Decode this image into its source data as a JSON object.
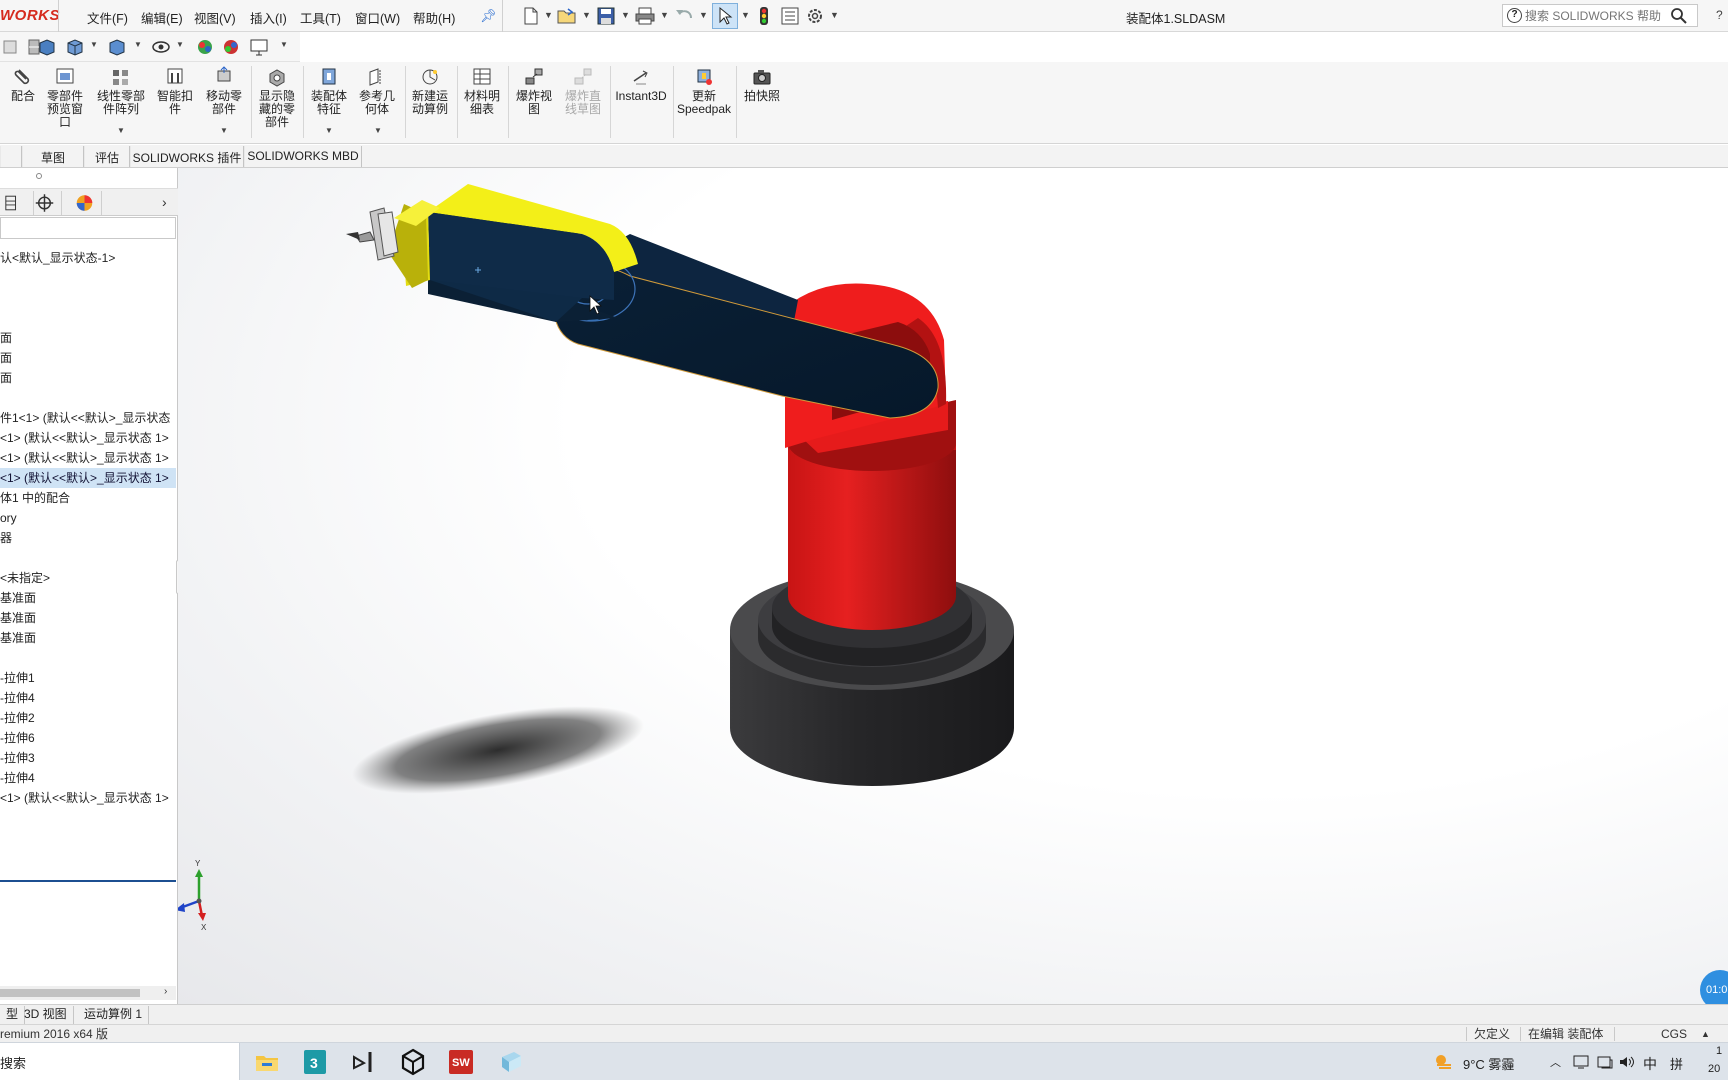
{
  "app": {
    "logo_text": "WORKS",
    "document_title": "装配体1.SLDASM"
  },
  "menu": {
    "items": [
      "文件(F)",
      "编辑(E)",
      "视图(V)",
      "插入(I)",
      "工具(T)",
      "窗口(W)",
      "帮助(H)"
    ]
  },
  "help_search": {
    "placeholder": "搜索 SOLIDWORKS 帮助",
    "help_label": "?"
  },
  "ribbon": {
    "buttons": [
      {
        "label": "配合",
        "icon": "paperclip-icon",
        "enabled": true
      },
      {
        "label": "零部件预览窗口",
        "lines": [
          "零部件",
          "预览窗",
          "口"
        ],
        "icon": "component-preview-icon",
        "enabled": true
      },
      {
        "label": "线性零部件阵列",
        "lines": [
          "线性零部",
          "件阵列"
        ],
        "icon": "linear-pattern-icon",
        "enabled": true
      },
      {
        "label": "智能扣件",
        "lines": [
          "智能扣",
          "件"
        ],
        "icon": "smart-fasteners-icon",
        "enabled": true
      },
      {
        "label": "移动零部件",
        "lines": [
          "移动零",
          "部件"
        ],
        "icon": "move-component-icon",
        "enabled": true
      },
      {
        "label": "显示隐藏的零部件",
        "lines": [
          "显示隐",
          "藏的零",
          "部件"
        ],
        "icon": "show-hidden-icon",
        "enabled": true
      },
      {
        "label": "装配体特征",
        "lines": [
          "装配体",
          "特征"
        ],
        "icon": "assembly-features-icon",
        "enabled": true
      },
      {
        "label": "参考几何体",
        "lines": [
          "参考几",
          "何体"
        ],
        "icon": "reference-geometry-icon",
        "enabled": true
      },
      {
        "label": "新建运动算例",
        "lines": [
          "新建运",
          "动算例"
        ],
        "icon": "new-motion-study-icon",
        "enabled": true
      },
      {
        "label": "材料明细表",
        "lines": [
          "材料明",
          "细表"
        ],
        "icon": "bill-of-materials-icon",
        "enabled": true
      },
      {
        "label": "爆炸视图",
        "lines": [
          "爆炸视",
          "图"
        ],
        "icon": "exploded-view-icon",
        "enabled": true
      },
      {
        "label": "爆炸直线草图",
        "lines": [
          "爆炸直",
          "线草图"
        ],
        "icon": "explode-line-sketch-icon",
        "enabled": false
      },
      {
        "label": "Instant3D",
        "lines": [
          "Instant3D"
        ],
        "icon": "instant3d-icon",
        "enabled": true
      },
      {
        "label": "更新Speedpak",
        "lines": [
          "更新",
          "Speedpak"
        ],
        "icon": "speedpak-icon",
        "enabled": true
      },
      {
        "label": "拍快照",
        "lines": [
          "拍快照"
        ],
        "icon": "camera-icon",
        "enabled": true
      }
    ]
  },
  "tabs": [
    "草图",
    "评估",
    "SOLIDWORKS 插件",
    "SOLIDWORKS MBD"
  ],
  "feature_tree": {
    "items": [
      {
        "text": "认<默认_显示状态-1>",
        "selected": false
      },
      {
        "text": "面",
        "selected": false
      },
      {
        "text": "面",
        "selected": false
      },
      {
        "text": "面",
        "selected": false
      },
      {
        "text": "件1<1> (默认<<默认>_显示状态",
        "selected": false
      },
      {
        "text": "<1> (默认<<默认>_显示状态 1>",
        "selected": false
      },
      {
        "text": "<1> (默认<<默认>_显示状态 1>",
        "selected": false
      },
      {
        "text": "<1> (默认<<默认>_显示状态 1>",
        "selected": true
      },
      {
        "text": "体1 中的配合",
        "selected": false
      },
      {
        "text": "ory",
        "selected": false
      },
      {
        "text": "器",
        "selected": false
      },
      {
        "text": "<未指定>",
        "selected": false
      },
      {
        "text": "基准面",
        "selected": false
      },
      {
        "text": "基准面",
        "selected": false
      },
      {
        "text": "基准面",
        "selected": false
      },
      {
        "text": "-拉伸1",
        "selected": false
      },
      {
        "text": "-拉伸4",
        "selected": false
      },
      {
        "text": "-拉伸2",
        "selected": false
      },
      {
        "text": "-拉伸6",
        "selected": false
      },
      {
        "text": "-拉伸3",
        "selected": false
      },
      {
        "text": "-拉伸4",
        "selected": false
      },
      {
        "text": "<1> (默认<<默认>_显示状态 1>",
        "selected": false
      }
    ]
  },
  "viewport": {
    "triad_labels": {
      "x": "X",
      "y": "Y",
      "z": "Z"
    },
    "timer_text": "01:0"
  },
  "bottom_tabs": [
    "型",
    "3D 视图",
    "运动算例 1"
  ],
  "status_bar": {
    "version": "remium 2016 x64 版",
    "state": "欠定义",
    "editing": "在编辑 装配体",
    "units": "CGS"
  },
  "taskbar": {
    "search_text": "搜索",
    "weather": "9°C  雾霾",
    "ime": "中",
    "ime_grid": "拼",
    "clock_top": "1",
    "clock_bottom": "20"
  },
  "colors": {
    "accent_blue": "#1c4f91",
    "solidworks_red": "#d52b1e",
    "base_dark": "#2a2a2c",
    "column_red": "#e21b1b",
    "arm_navy": "#0e2a44",
    "gripper_yellow": "#f1ef1a"
  }
}
